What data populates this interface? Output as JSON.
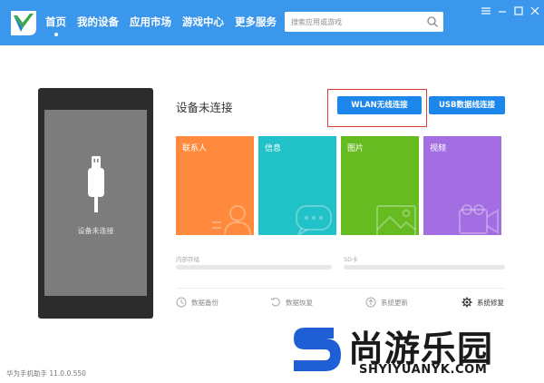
{
  "header": {
    "nav": [
      {
        "label": "首页",
        "active": true
      },
      {
        "label": "我的设备",
        "active": false
      },
      {
        "label": "应用市场",
        "active": false
      },
      {
        "label": "游戏中心",
        "active": false
      },
      {
        "label": "更多服务",
        "active": false
      }
    ],
    "search": {
      "placeholder": "搜索应用或游戏"
    },
    "window_controls": [
      "menu-icon",
      "minimize-icon",
      "maximize-icon",
      "close-icon"
    ]
  },
  "phone": {
    "status": "设备未连接"
  },
  "main": {
    "status_title": "设备未连接",
    "wlan_button": "WLAN无线连接",
    "usb_button": "USB数据线连接",
    "tiles": [
      {
        "label": "联系人",
        "icon": "contacts-icon",
        "color": "#ff8a3d"
      },
      {
        "label": "信息",
        "icon": "message-icon",
        "color": "#21c1c8"
      },
      {
        "label": "图片",
        "icon": "picture-icon",
        "color": "#65bb1f"
      },
      {
        "label": "视频",
        "icon": "video-icon",
        "color": "#a36ee1"
      }
    ],
    "storage": {
      "internal_label": "内部存储",
      "sd_label": "SD卡"
    },
    "actions": [
      {
        "label": "数据备份",
        "icon": "backup-icon"
      },
      {
        "label": "数据恢复",
        "icon": "restore-icon"
      },
      {
        "label": "系统更新",
        "icon": "update-icon"
      },
      {
        "label": "系统修复",
        "icon": "gear-icon"
      }
    ]
  },
  "footer": {
    "version": "华为手机助手 11.0.0.550"
  },
  "watermark": {
    "text": "尚游乐园",
    "url": "SHYIYUANYK.COM"
  },
  "colors": {
    "header": "#3b97ec",
    "button": "#1b86eb",
    "highlight": "#e23a2e"
  }
}
